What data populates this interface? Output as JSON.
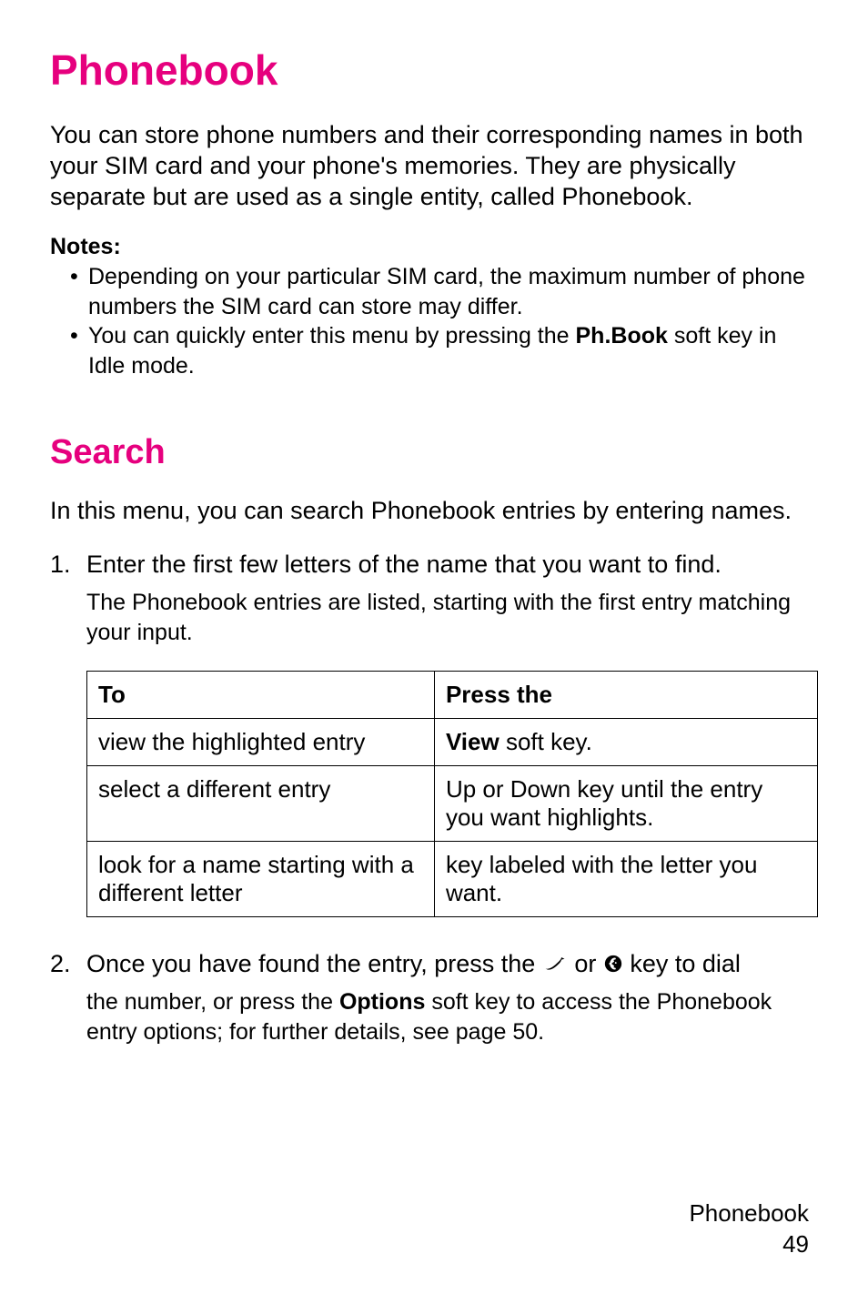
{
  "title": "Phonebook",
  "intro": "You can store phone numbers and their corresponding names in both your SIM card and your phone's memories. They are physically separate but are used as a single entity, called Phonebook.",
  "notes": {
    "label": "Notes:",
    "items": [
      {
        "pre": "Depending on your particular SIM card, the maximum number of phone numbers the SIM card can store may differ."
      },
      {
        "pre": "You can quickly enter this menu by pressing the ",
        "bold": "Ph.Book",
        "post": " soft key in Idle mode."
      }
    ]
  },
  "search": {
    "heading": "Search",
    "intro": "In this menu, you can search Phonebook entries by entering names.",
    "step1": {
      "num": "1.",
      "text": "Enter the first few letters of the name that you want to find.",
      "sub": "The Phonebook entries are listed, starting with the first entry matching your input."
    },
    "table": {
      "h1": "To",
      "h2": "Press the",
      "rows": [
        {
          "to": "view the highlighted entry",
          "press_bold": "View",
          "press_post": " soft key."
        },
        {
          "to": "select a different entry",
          "press_post": "Up or Down key until the entry you want highlights."
        },
        {
          "to": "look for a name starting with a different letter",
          "press_post": "key labeled with the letter you want."
        }
      ]
    },
    "step2": {
      "num": "2.",
      "pre": "Once you have found the entry, press the ",
      "between": " or ",
      "post": " key to dial",
      "sub_pre": "the number, or press the ",
      "sub_bold": "Options",
      "sub_post": " soft key to access the Phonebook entry options; for further details, see page 50."
    }
  },
  "footer": {
    "section": "Phonebook",
    "page": "49"
  }
}
